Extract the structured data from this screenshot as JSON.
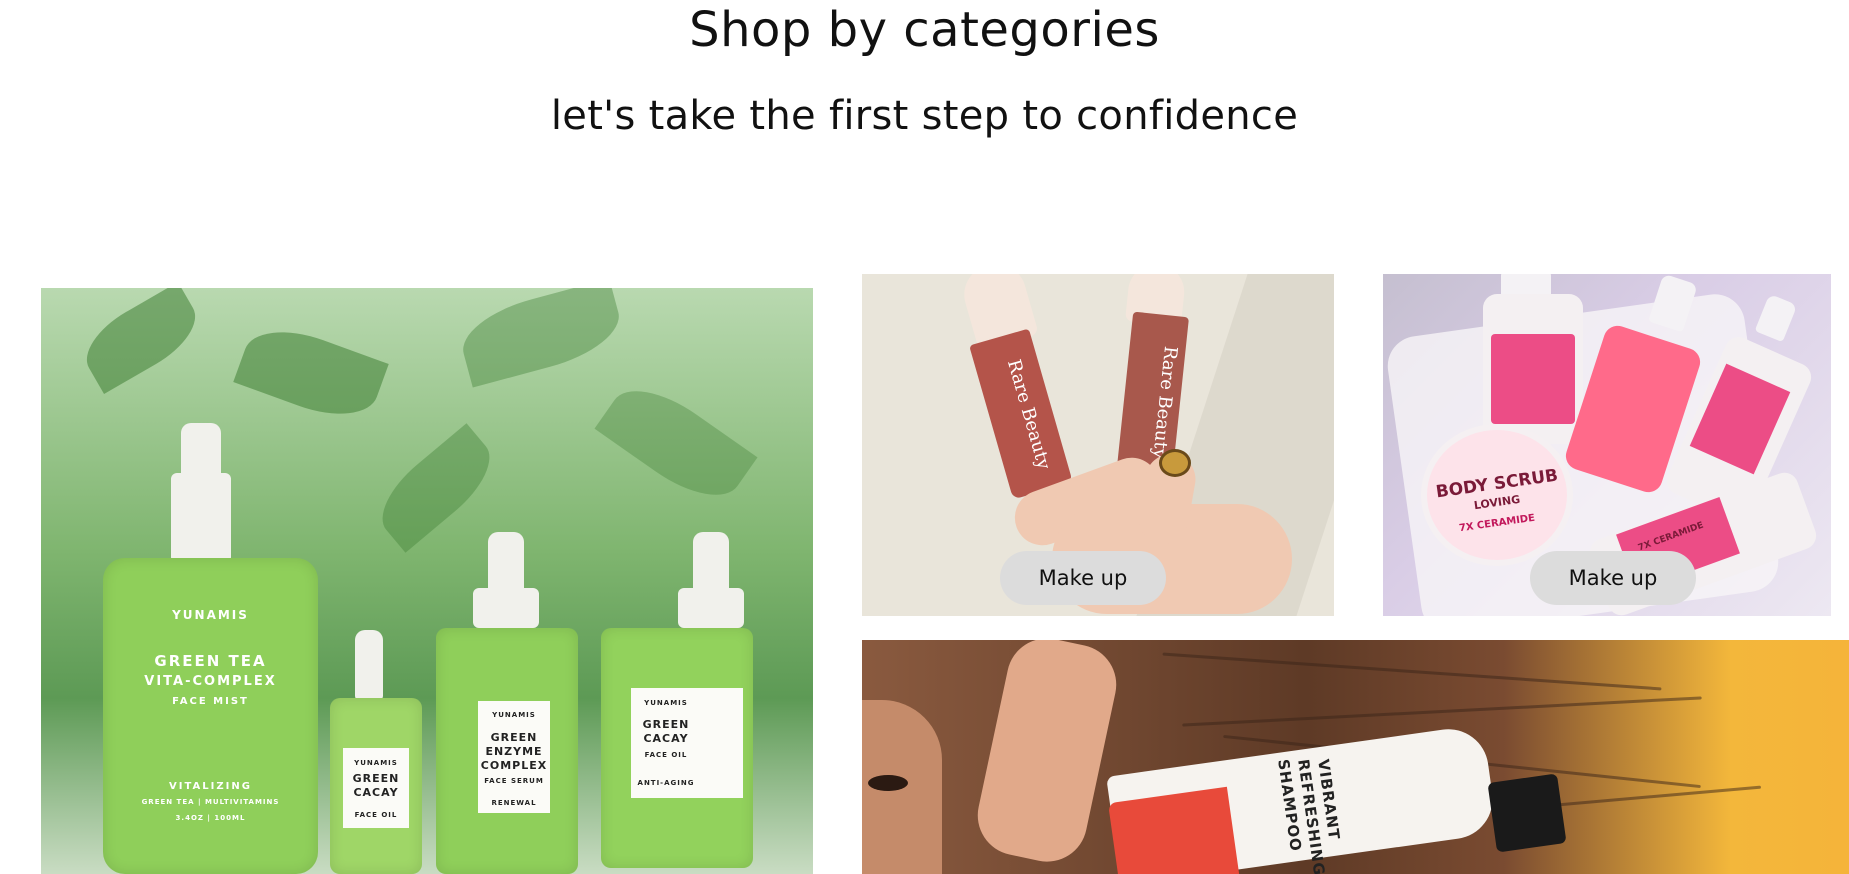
{
  "section": {
    "title": "Shop by categories",
    "subtitle": "let's take the first step to confidence"
  },
  "tiles": {
    "skincare": {
      "brand": "YUNAMIS",
      "big_bottle_lines": [
        "GREEN TEA",
        "VITA-COMPLEX",
        "FACE MIST"
      ],
      "big_bottle_footer": [
        "VITALIZING",
        "GREEN TEA | MULTIVITAMINS",
        "3.4OZ | 100ML"
      ],
      "small_bottle_lines": [
        "YUNAMIS",
        "GREEN",
        "CACAY",
        "FACE OIL"
      ],
      "enzyme_bottle_lines": [
        "YUNAMIS",
        "GREEN",
        "ENZYME",
        "COMPLEX",
        "FACE SERUM",
        "RENEWAL"
      ],
      "cacay_bottle_lines": [
        "YUNAMIS",
        "GREEN",
        "CACAY",
        "FACE OIL",
        "ANTI-AGING"
      ]
    },
    "makeup_1": {
      "tube_text_1": "Rare Beauty",
      "tube_text_2": "Rare Beauty",
      "button_label": "Make up"
    },
    "makeup_2": {
      "scrub_lines": [
        "BODY SCRUB",
        "LOVING",
        "7X CERAMIDE"
      ],
      "bottle_text": "7X CERAMIDE",
      "button_label": "Make up"
    },
    "haircare": {
      "shampoo_lines": [
        "VIBRANT",
        "REFRESHING",
        "SHAMPOO"
      ]
    }
  },
  "colors": {
    "pill_bg": "#dcdcdc",
    "skincare_green": "#8fcf5a",
    "makeup_tube": "#b4544a",
    "body_pink": "#ee5a8a",
    "hair_yellow": "#f5b43a"
  }
}
